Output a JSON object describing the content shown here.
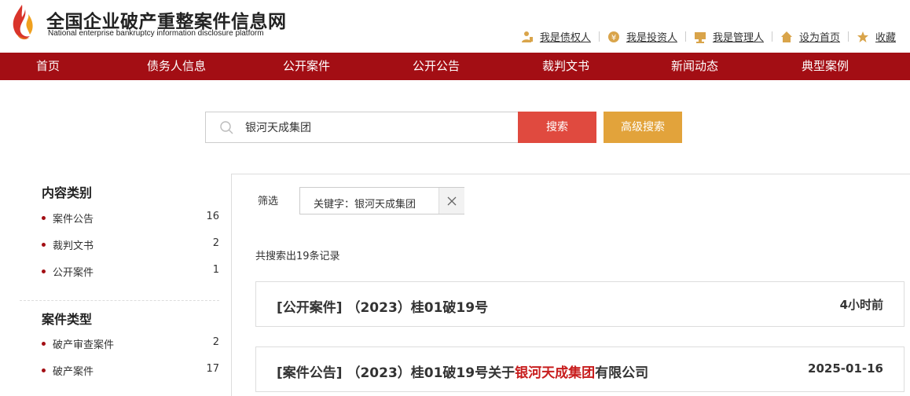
{
  "header": {
    "title": "全国企业破产重整案件信息网",
    "subtitle": "National enterprise bankruptcy  information disclosure platform",
    "links": [
      {
        "label": "我是债权人",
        "icon": "creditor-icon"
      },
      {
        "label": "我是投资人",
        "icon": "investor-icon"
      },
      {
        "label": "我是管理人",
        "icon": "manager-icon"
      },
      {
        "label": "设为首页",
        "icon": "home-icon"
      },
      {
        "label": "收藏",
        "icon": "star-icon"
      }
    ]
  },
  "nav": [
    "首页",
    "债务人信息",
    "公开案件",
    "公开公告",
    "裁判文书",
    "新闻动态",
    "典型案例"
  ],
  "search": {
    "value": "银河天成集团",
    "button": "搜索",
    "advanced": "高级搜索"
  },
  "sidebar": {
    "content_type": {
      "title": "内容类别",
      "items": [
        {
          "label": "案件公告",
          "count": "16"
        },
        {
          "label": "裁判文书",
          "count": "2"
        },
        {
          "label": "公开案件",
          "count": "1"
        }
      ]
    },
    "case_type": {
      "title": "案件类型",
      "items": [
        {
          "label": "破产审查案件",
          "count": "2"
        },
        {
          "label": "破产案件",
          "count": "17"
        }
      ]
    }
  },
  "filter": {
    "label": "筛选",
    "tag": "关键字：银河天成集团"
  },
  "results": {
    "count_text": "共搜索出19条记录",
    "items": [
      {
        "prefix": "[公开案件] （2023）桂01破19号",
        "highlight": "",
        "suffix": "",
        "time": "4小时前"
      },
      {
        "prefix": "[案件公告] （2023）桂01破19号关于",
        "highlight": "银河天成集团",
        "suffix": "有限公司",
        "time": "2025-01-16"
      }
    ]
  },
  "colors": {
    "nav_bg": "#a30e14",
    "search_button": "#e04a3f",
    "advanced_button": "#e2a33b",
    "highlight": "#c81e1e"
  }
}
